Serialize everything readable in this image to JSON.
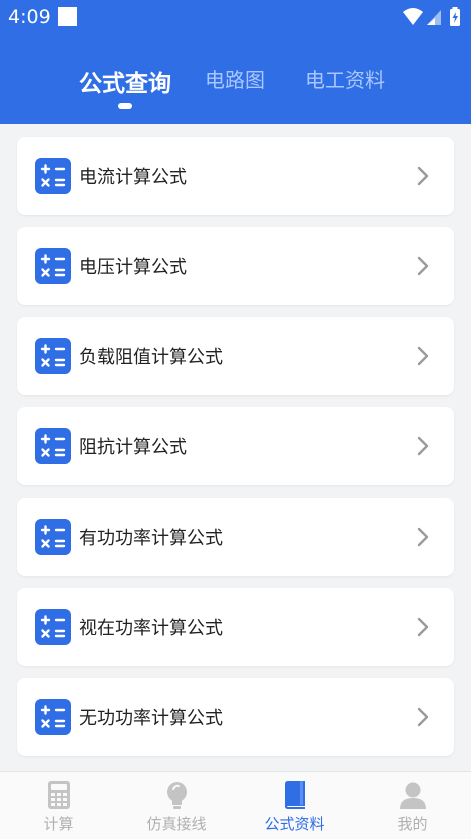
{
  "status": {
    "time": "4:09"
  },
  "header": {
    "tabs": [
      {
        "label": "公式查询",
        "active": true
      },
      {
        "label": "电路图",
        "active": false
      },
      {
        "label": "电工资料",
        "active": false
      }
    ]
  },
  "list": {
    "items": [
      {
        "label": "电流计算公式",
        "icon": "calculator-icon"
      },
      {
        "label": "电压计算公式",
        "icon": "calculator-icon"
      },
      {
        "label": "负载阻值计算公式",
        "icon": "calculator-icon"
      },
      {
        "label": "阻抗计算公式",
        "icon": "calculator-icon"
      },
      {
        "label": "有功功率计算公式",
        "icon": "calculator-icon"
      },
      {
        "label": "视在功率计算公式",
        "icon": "calculator-icon"
      },
      {
        "label": "无功功率计算公式",
        "icon": "calculator-icon"
      }
    ]
  },
  "tabbar": {
    "items": [
      {
        "label": "计算",
        "icon": "calculator-icon",
        "active": false
      },
      {
        "label": "仿真接线",
        "icon": "lightbulb-icon",
        "active": false
      },
      {
        "label": "公式资料",
        "icon": "book-icon",
        "active": true
      },
      {
        "label": "我的",
        "icon": "person-icon",
        "active": false
      }
    ]
  },
  "colors": {
    "accent": "#2f6ee5",
    "inactive_tab": "#a9c6ff",
    "tabbar_inactive": "#b0b0b0"
  }
}
